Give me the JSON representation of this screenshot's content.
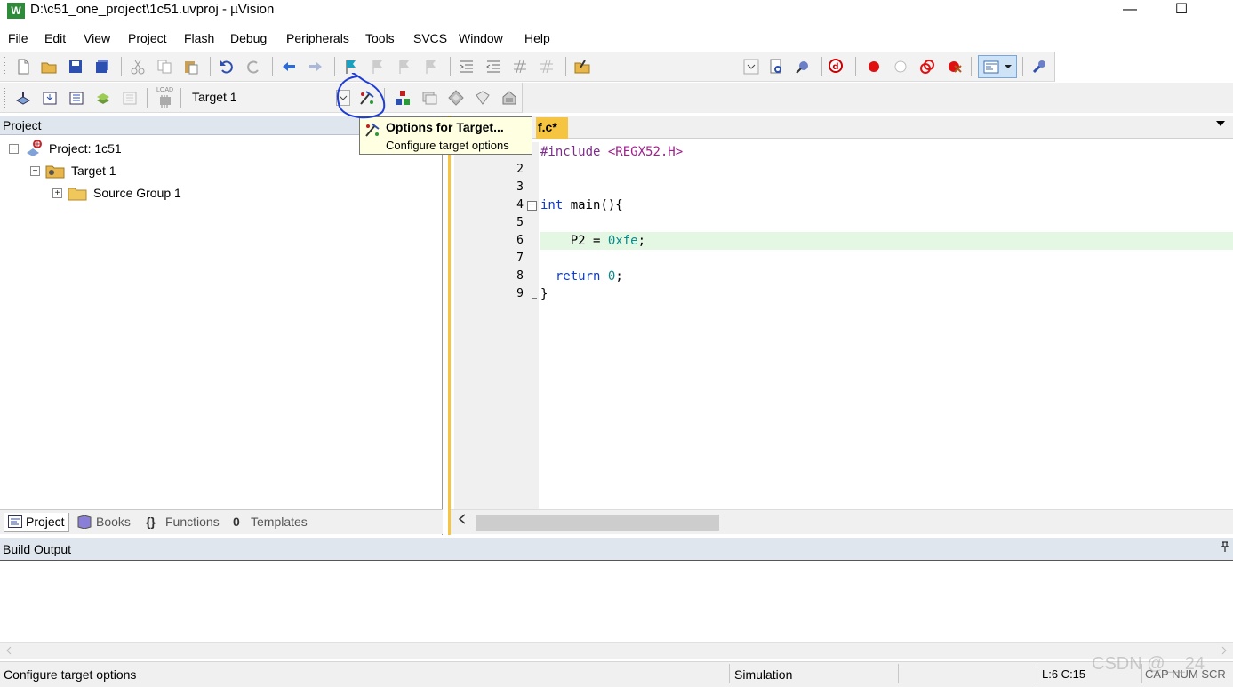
{
  "window": {
    "title": "D:\\c51_one_project\\1c51.uvproj - µVision",
    "logo_text": "W",
    "minimize": "—",
    "maximize": "☐"
  },
  "menu": [
    "File",
    "Edit",
    "View",
    "Project",
    "Flash",
    "Debug",
    "Peripherals",
    "Tools",
    "SVCS",
    "Window",
    "Help"
  ],
  "toolbar2": {
    "load_label": "LOAD",
    "target_combo": "Target 1"
  },
  "project_panel": {
    "title": "Project",
    "tree": {
      "project": "Project: 1c51",
      "target": "Target 1",
      "group": "Source Group 1"
    },
    "tabs": [
      "Project",
      "Books",
      "Functions",
      "Templates"
    ]
  },
  "editor": {
    "tab_label": "f.c*",
    "line_numbers": [
      "1",
      "2",
      "3",
      "4",
      "5",
      "6",
      "7",
      "8",
      "9"
    ],
    "code": {
      "l1_directive": "#include",
      "l1_header": "<REGX52.H>",
      "l4_kw": "int",
      "l4_rest": " main(){",
      "l6_lhs": "    P2 = ",
      "l6_val": "0xfe",
      "l6_end": ";",
      "l8_kw": "  return",
      "l8_sp": " ",
      "l8_val": "0",
      "l8_end": ";",
      "l9": "}"
    },
    "highlight_line": "6"
  },
  "tooltip": {
    "title": "Options for Target...",
    "description": "Configure target options"
  },
  "build_output": {
    "title": "Build Output"
  },
  "statusbar": {
    "message": "Configure target options",
    "mode": "Simulation",
    "position": "L:6 C:15",
    "indicators": "CAP NUM SCR"
  },
  "watermark": "CSDN @__24",
  "colors": {
    "accent_tab": "#f5c542",
    "panel_header": "#dfe6ee",
    "keyword": "#0b3ad6",
    "number": "#0a8a8a",
    "highlight_line": "#e3f7e3",
    "annotation": "#1f3dd6"
  }
}
